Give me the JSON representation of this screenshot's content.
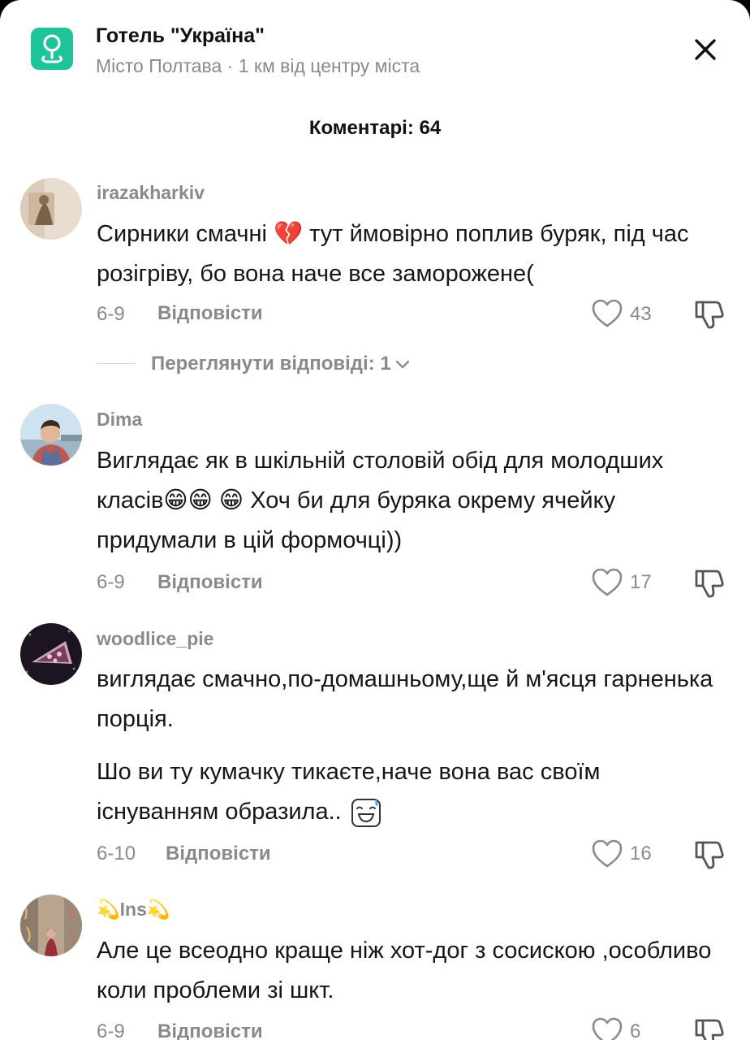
{
  "header": {
    "location_icon": "location-pin-icon",
    "title": "Готель \"Україна\"",
    "subtitle": "Місто Полтава · 1 км від центру міста",
    "close_icon": "close-icon"
  },
  "comments_header": "Коментарі: 64",
  "reply_label": "Відповісти",
  "comments": [
    {
      "username": "irazakharkiv",
      "paragraphs": [
        "Сирники смачні 💔 тут ймовірно поплив буряк, під час розігріву, бо вона наче все заморожене("
      ],
      "date": "6-9",
      "likes": "43",
      "view_replies": "Переглянути відповіді: 1"
    },
    {
      "username": "Dima",
      "paragraphs": [
        "Виглядає як в шкільній столовій обід для молодших класів😁😁 😁 Хоч би для буряка окрему ячейку придумали в цій формочці))"
      ],
      "date": "6-9",
      "likes": "17"
    },
    {
      "username": "woodlice_pie",
      "paragraphs": [
        "виглядає смачно,по-домашньому,ще й м'ясця гарненька порція.",
        "Шо ви ту кумачку тикаєте,наче вона вас своїм існуванням образила.."
      ],
      "date": "6-10",
      "likes": "16"
    },
    {
      "username": "💫Ins💫",
      "paragraphs": [
        "Але це всеодно краще ніж хот-дог з сосискою ,особливо коли проблеми зі шкт."
      ],
      "date": "6-9",
      "likes": "6"
    }
  ],
  "icons": {
    "like": "heart-outline-icon",
    "dislike": "thumbs-down-icon",
    "expand": "chevron-down-icon"
  }
}
